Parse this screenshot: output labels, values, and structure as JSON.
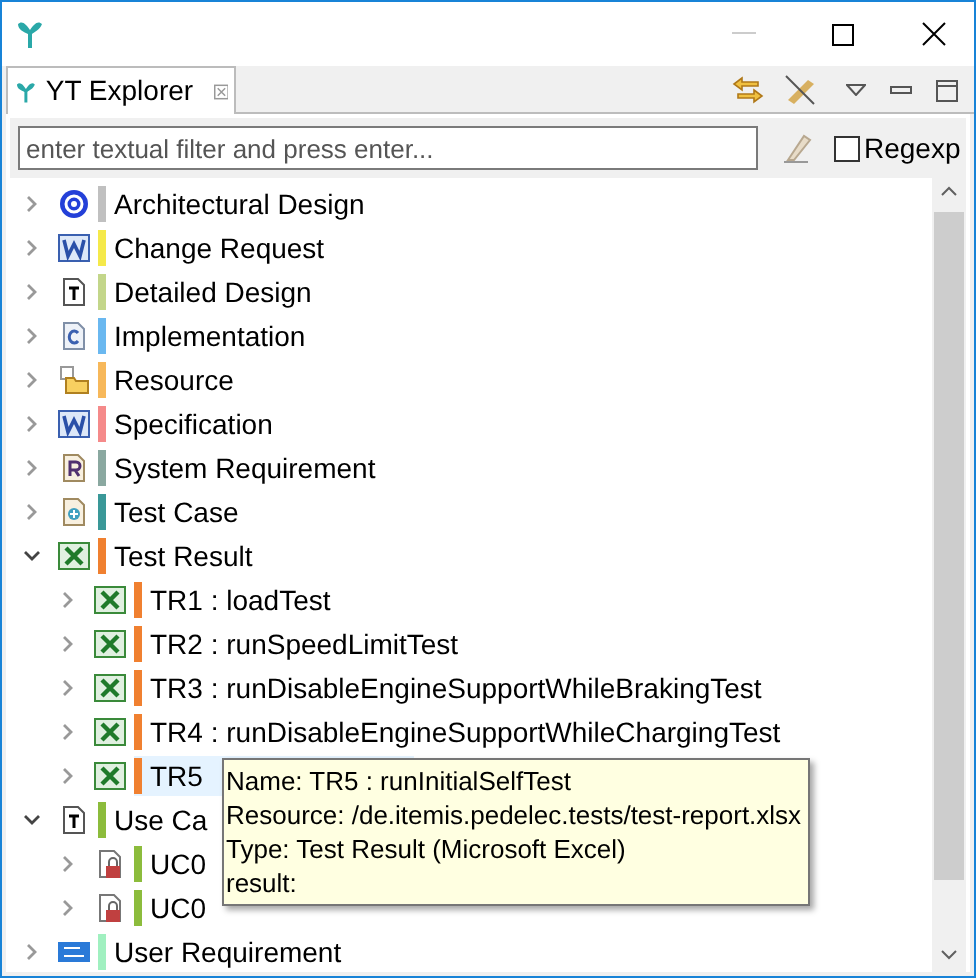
{
  "view_tab": {
    "title": "YT Explorer",
    "selected": true
  },
  "filter": {
    "placeholder": "enter textual filter and press enter..."
  },
  "regexp": {
    "label": "Regexp",
    "checked": false
  },
  "tree": [
    {
      "label": "Architectural Design",
      "kind": "gear",
      "color": "#c0c0c0",
      "expanded": false,
      "selected": false
    },
    {
      "label": "Change Request",
      "kind": "word",
      "color": "#f5e94a",
      "expanded": false,
      "selected": false
    },
    {
      "label": "Detailed Design",
      "kind": "text",
      "color": "#c3d68a",
      "expanded": false,
      "selected": false
    },
    {
      "label": "Implementation",
      "kind": "code",
      "color": "#6ab8f0",
      "expanded": false,
      "selected": false
    },
    {
      "label": "Resource",
      "kind": "folder",
      "color": "#f7b85a",
      "expanded": false,
      "selected": false
    },
    {
      "label": "Specification",
      "kind": "word",
      "color": "#f58a8a",
      "expanded": false,
      "selected": false
    },
    {
      "label": "System Requirement",
      "kind": "rfile",
      "color": "#8aa8a0",
      "expanded": false,
      "selected": false
    },
    {
      "label": "Test Case",
      "kind": "testcase",
      "color": "#3a9898",
      "expanded": false,
      "selected": false
    },
    {
      "label": "Test Result",
      "kind": "excel",
      "color": "#f08030",
      "expanded": true,
      "selected": false,
      "children": [
        {
          "label": "TR1 : loadTest",
          "kind": "excel",
          "color": "#f08030",
          "expanded": false,
          "selected": false
        },
        {
          "label": "TR2 : runSpeedLimitTest",
          "kind": "excel",
          "color": "#f08030",
          "expanded": false,
          "selected": false
        },
        {
          "label": "TR3 : runDisableEngineSupportWhileBrakingTest",
          "kind": "excel",
          "color": "#f08030",
          "expanded": false,
          "selected": false
        },
        {
          "label": "TR4 : runDisableEngineSupportWhileChargingTest",
          "kind": "excel",
          "color": "#f08030",
          "expanded": false,
          "selected": false
        },
        {
          "label": "TR5",
          "kind": "excel",
          "color": "#f08030",
          "expanded": false,
          "selected": true
        }
      ]
    },
    {
      "label": "Use Ca",
      "kind": "text",
      "color": "#8cbc3c",
      "expanded": true,
      "selected": false,
      "children": [
        {
          "label": "UC0",
          "kind": "lock",
          "color": "#8cbc3c",
          "expanded": false,
          "selected": false
        },
        {
          "label": "UC0",
          "kind": "lock",
          "color": "#8cbc3c",
          "expanded": false,
          "selected": false
        }
      ]
    },
    {
      "label": "User Requirement",
      "kind": "ptc",
      "color": "#a0f0c0",
      "expanded": false,
      "selected": false
    }
  ],
  "tooltip": [
    "Name: TR5 : runInitialSelfTest",
    "Resource: /de.itemis.pedelec.tests/test-report.xlsx",
    "Type: Test Result (Microsoft Excel)",
    "result:"
  ]
}
